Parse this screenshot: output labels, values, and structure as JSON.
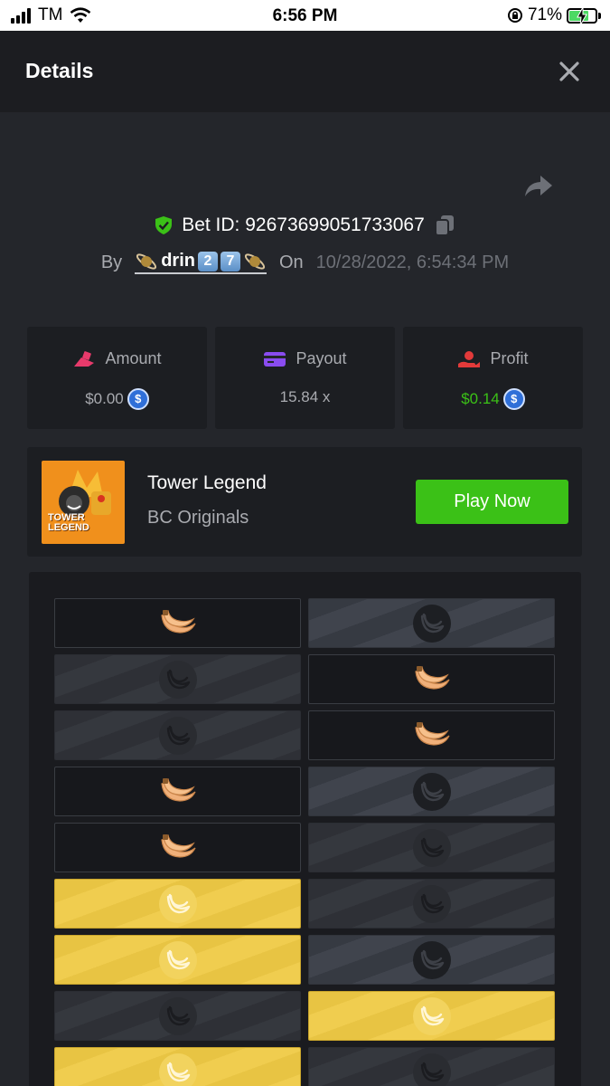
{
  "status_bar": {
    "carrier": "TM",
    "time": "6:56 PM",
    "battery": "71%"
  },
  "header": {
    "title": "Details",
    "close_icon": "close-icon"
  },
  "bet": {
    "id_label": "Bet ID: 92673699051733067",
    "by_label": "By",
    "username": "drin",
    "username_keycaps": [
      "2",
      "7"
    ],
    "on_label": "On",
    "datetime": "10/28/2022, 6:54:34 PM"
  },
  "stats": {
    "amount_label": "Amount",
    "amount_value": "$0.00",
    "payout_label": "Payout",
    "payout_value": "15.84 x",
    "profit_label": "Profit",
    "profit_value": "$0.14",
    "coin_symbol": "$"
  },
  "game": {
    "name": "Tower Legend",
    "provider": "BC Originals",
    "thumb_text": "TOWER LEGEND",
    "play_label": "Play Now"
  },
  "colors": {
    "accent_green": "#3bc117",
    "background": "#24262b",
    "gold_tile": "#e8c443"
  },
  "tower": {
    "tile_types": "pick = chosen banana, dark/slate = unrevealed, gold = winning row reveal",
    "rows": [
      [
        "pick",
        "slate"
      ],
      [
        "dark",
        "pick"
      ],
      [
        "dark",
        "pick"
      ],
      [
        "pick",
        "slate"
      ],
      [
        "pick",
        "dark"
      ],
      [
        "gold",
        "dark"
      ],
      [
        "gold",
        "slate"
      ],
      [
        "dark",
        "gold"
      ],
      [
        "gold",
        "dark"
      ]
    ]
  }
}
